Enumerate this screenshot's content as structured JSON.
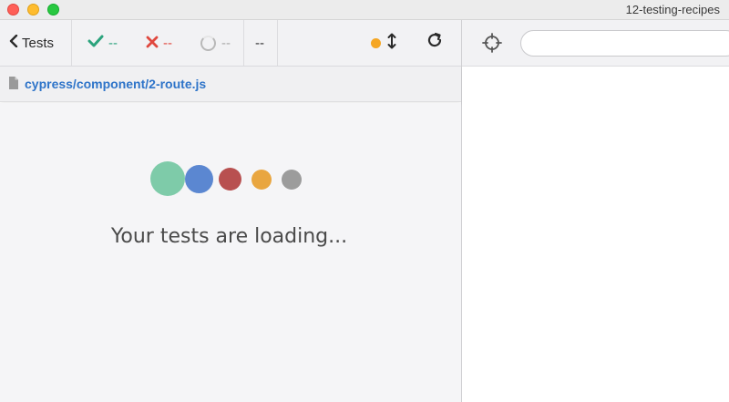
{
  "window": {
    "title": "12-testing-recipes"
  },
  "toolbar": {
    "back_label": "Tests",
    "passed": "--",
    "failed": "--",
    "pending": "--",
    "duration": "--",
    "status_dot_color": "#f5a623"
  },
  "spec": {
    "path": "cypress/component/2-route.js"
  },
  "reporter": {
    "loading_message": "Your tests are loading...",
    "loader_colors": [
      "#7ecba9",
      "#5b87d1",
      "#b85050",
      "#e9a640",
      "#9c9c9c"
    ]
  },
  "aut": {
    "url": ""
  },
  "icons": {
    "back": "chevron-left-icon",
    "passed": "check-icon",
    "failed": "x-icon",
    "pending": "spinner-icon",
    "scroll": "arrows-vertical-icon",
    "reload": "reload-icon",
    "selector": "crosshair-icon",
    "file": "file-icon"
  },
  "colors": {
    "pass": "#2ba37c",
    "fail": "#e0483e",
    "link": "#2e74c9"
  }
}
